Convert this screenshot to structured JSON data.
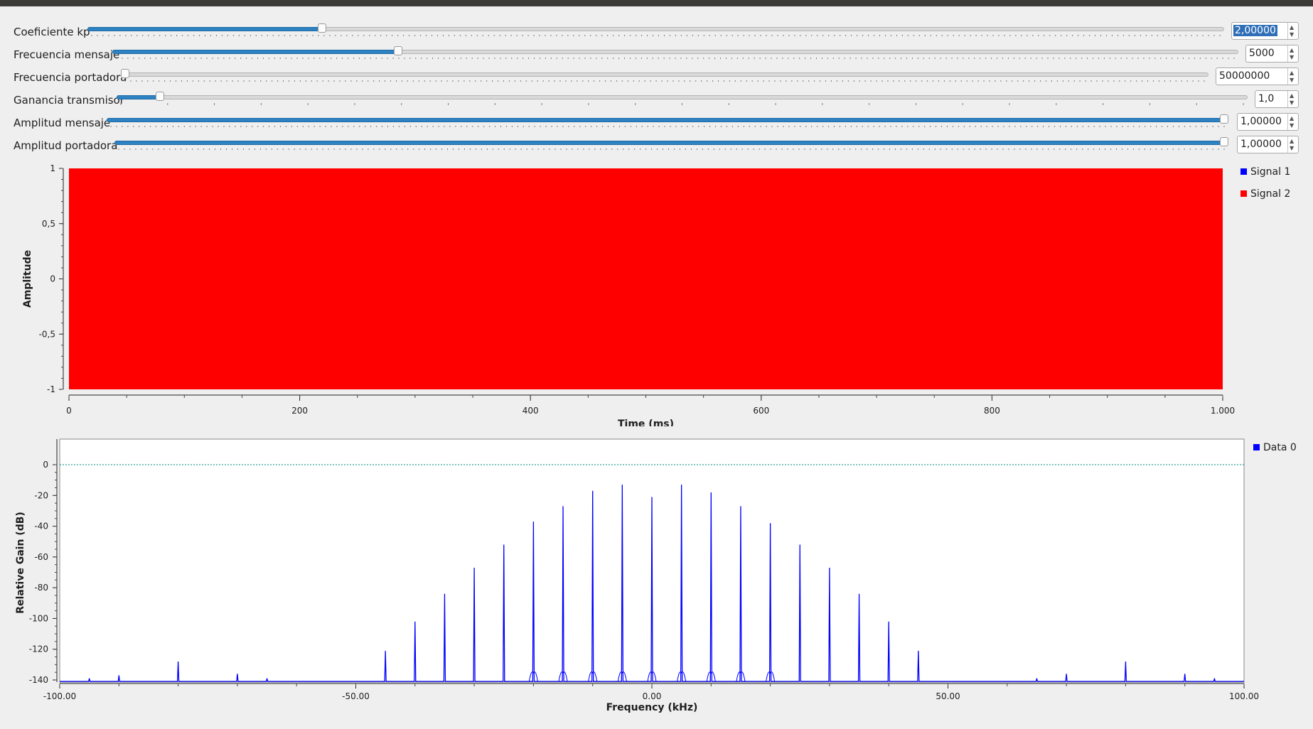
{
  "controls": [
    {
      "label": "Coeficiente kp",
      "value": "2,00000",
      "fraction": 0.204,
      "selected": true,
      "ticks": "dense"
    },
    {
      "label": "Frecuencia mensaje",
      "value": "5000",
      "fraction": 0.252,
      "selected": false,
      "ticks": "dense"
    },
    {
      "label": "Frecuencia portadora",
      "value": "50000000",
      "fraction": 0.0,
      "selected": false,
      "ticks": "dense"
    },
    {
      "label": "Ganancia transmisor",
      "value": "1,0",
      "fraction": 0.035,
      "selected": false,
      "ticks": "sparse"
    },
    {
      "label": "Amplitud mensaje",
      "value": "1,00000",
      "fraction": 1.0,
      "selected": false,
      "ticks": "dense"
    },
    {
      "label": "Amplitud portadora",
      "value": "1,00000",
      "fraction": 1.0,
      "selected": false,
      "ticks": "dense"
    }
  ],
  "time_plot": {
    "xlabel": "Time (ms)",
    "ylabel": "Amplitude",
    "xticks": [
      "0",
      "200",
      "400",
      "600",
      "800",
      "1.000"
    ],
    "yticks": [
      "1",
      "0,5",
      "0",
      "-0,5",
      "-1"
    ],
    "legend": [
      {
        "label": "Signal 1",
        "color": "#0000ff"
      },
      {
        "label": "Signal 2",
        "color": "#ff0000"
      }
    ],
    "fill_color": "#ff0000"
  },
  "freq_plot": {
    "xlabel": "Frequency (kHz)",
    "ylabel": "Relative Gain (dB)",
    "xticks": [
      "-100.00",
      "-50.00",
      "0.00",
      "50.00",
      "100.00"
    ],
    "yticks": [
      "0",
      "-20",
      "-40",
      "-60",
      "-80",
      "-100",
      "-120",
      "-140"
    ],
    "legend": [
      {
        "label": "Data 0",
        "color": "#0000ff"
      }
    ],
    "line_color": "#0000ff",
    "ref_line_color": "#2aa198"
  },
  "chart_data": [
    {
      "type": "line",
      "xlabel": "Time (ms)",
      "ylabel": "Amplitude",
      "xlim": [
        0,
        1000
      ],
      "ylim": [
        -1,
        1
      ],
      "series": [
        {
          "name": "Signal 1",
          "color": "#0000ff",
          "x": [
            0,
            1000
          ],
          "y": [
            0,
            0
          ]
        },
        {
          "name": "Signal 2",
          "color": "#ff0000",
          "x": [
            0,
            1000
          ],
          "y_min": [
            -1,
            -1
          ],
          "y_max": [
            1,
            1
          ]
        }
      ]
    },
    {
      "type": "line",
      "xlabel": "Frequency (kHz)",
      "ylabel": "Relative Gain (dB)",
      "xlim": [
        -100,
        100
      ],
      "ylim": [
        -140,
        0
      ],
      "series": [
        {
          "name": "Data 0",
          "color": "#0000ff",
          "x": [
            -95,
            -90,
            -80,
            -70,
            -65,
            -45,
            -40,
            -35,
            -30,
            -25,
            -20,
            -15,
            -10,
            -5,
            0,
            5,
            10,
            15,
            20,
            25,
            30,
            35,
            40,
            45,
            65,
            70,
            80,
            90,
            95
          ],
          "y": [
            -139,
            -137,
            -128,
            -136,
            -139,
            -121,
            -102,
            -84,
            -67,
            -52,
            -37,
            -27,
            -17,
            -13,
            -21,
            -13,
            -18,
            -27,
            -38,
            -52,
            -67,
            -84,
            -102,
            -121,
            -139,
            -136,
            -128,
            -136,
            -139
          ]
        }
      ]
    }
  ]
}
